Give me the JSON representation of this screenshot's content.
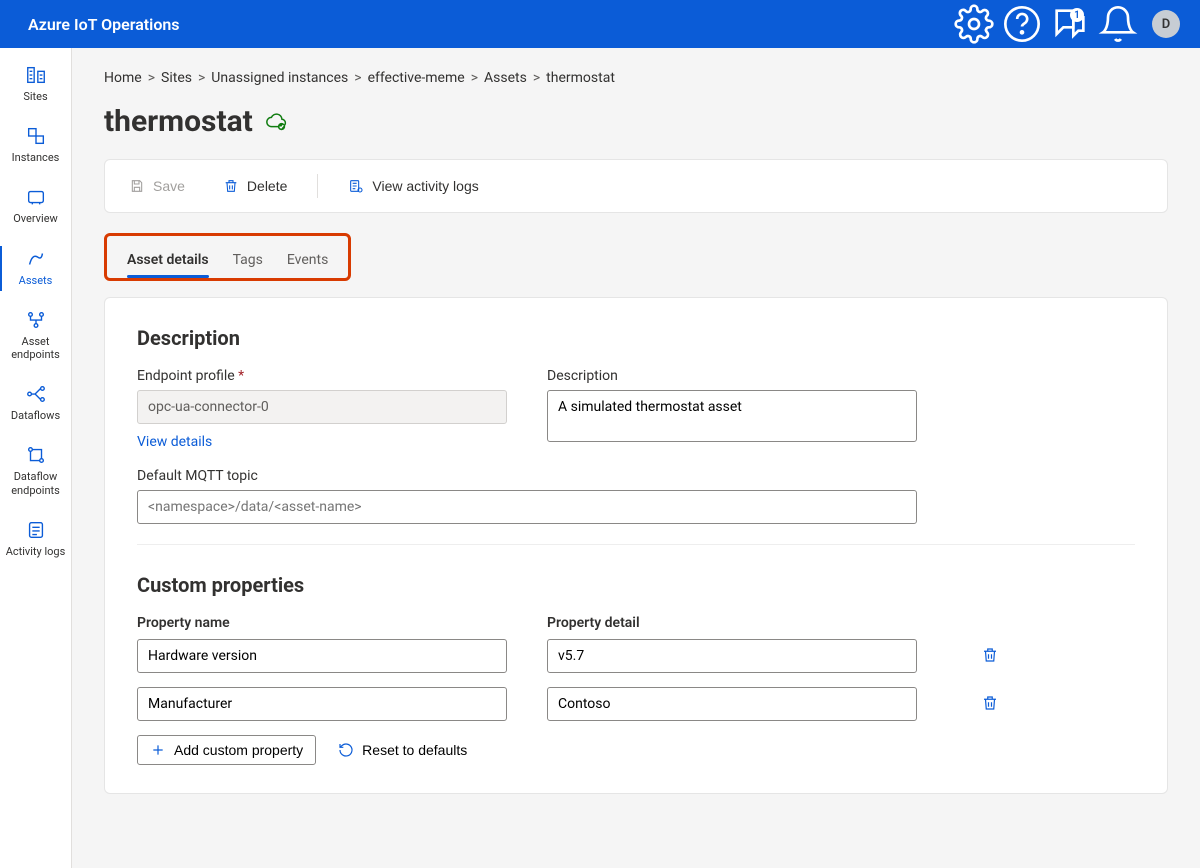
{
  "app_title": "Azure IoT Operations",
  "notif_badge": "1",
  "user_initial": "D",
  "breadcrumbs": [
    "Home",
    "Sites",
    "Unassigned instances",
    "effective-meme",
    "Assets",
    "thermostat"
  ],
  "page_title": "thermostat",
  "nav": {
    "sites": "Sites",
    "instances": "Instances",
    "overview": "Overview",
    "assets": "Assets",
    "asset_endpoints": "Asset endpoints",
    "dataflows": "Dataflows",
    "dataflow_endpoints": "Dataflow endpoints",
    "activity_logs": "Activity logs"
  },
  "actions": {
    "save": "Save",
    "delete": "Delete",
    "view_logs": "View activity logs"
  },
  "tabs": {
    "details": "Asset details",
    "tags": "Tags",
    "events": "Events"
  },
  "desc_section": {
    "title": "Description",
    "endpoint_label": "Endpoint profile",
    "endpoint_value": "opc-ua-connector-0",
    "view_details": "View details",
    "description_label": "Description",
    "description_value": "A simulated thermostat asset",
    "mqtt_label": "Default MQTT topic",
    "mqtt_placeholder": "<namespace>/data/<asset-name>"
  },
  "custom_section": {
    "title": "Custom properties",
    "name_header": "Property name",
    "detail_header": "Property detail",
    "rows": [
      {
        "name": "Hardware version",
        "detail": "v5.7"
      },
      {
        "name": "Manufacturer",
        "detail": "Contoso"
      }
    ],
    "add_label": "Add custom property",
    "reset_label": "Reset to defaults"
  }
}
